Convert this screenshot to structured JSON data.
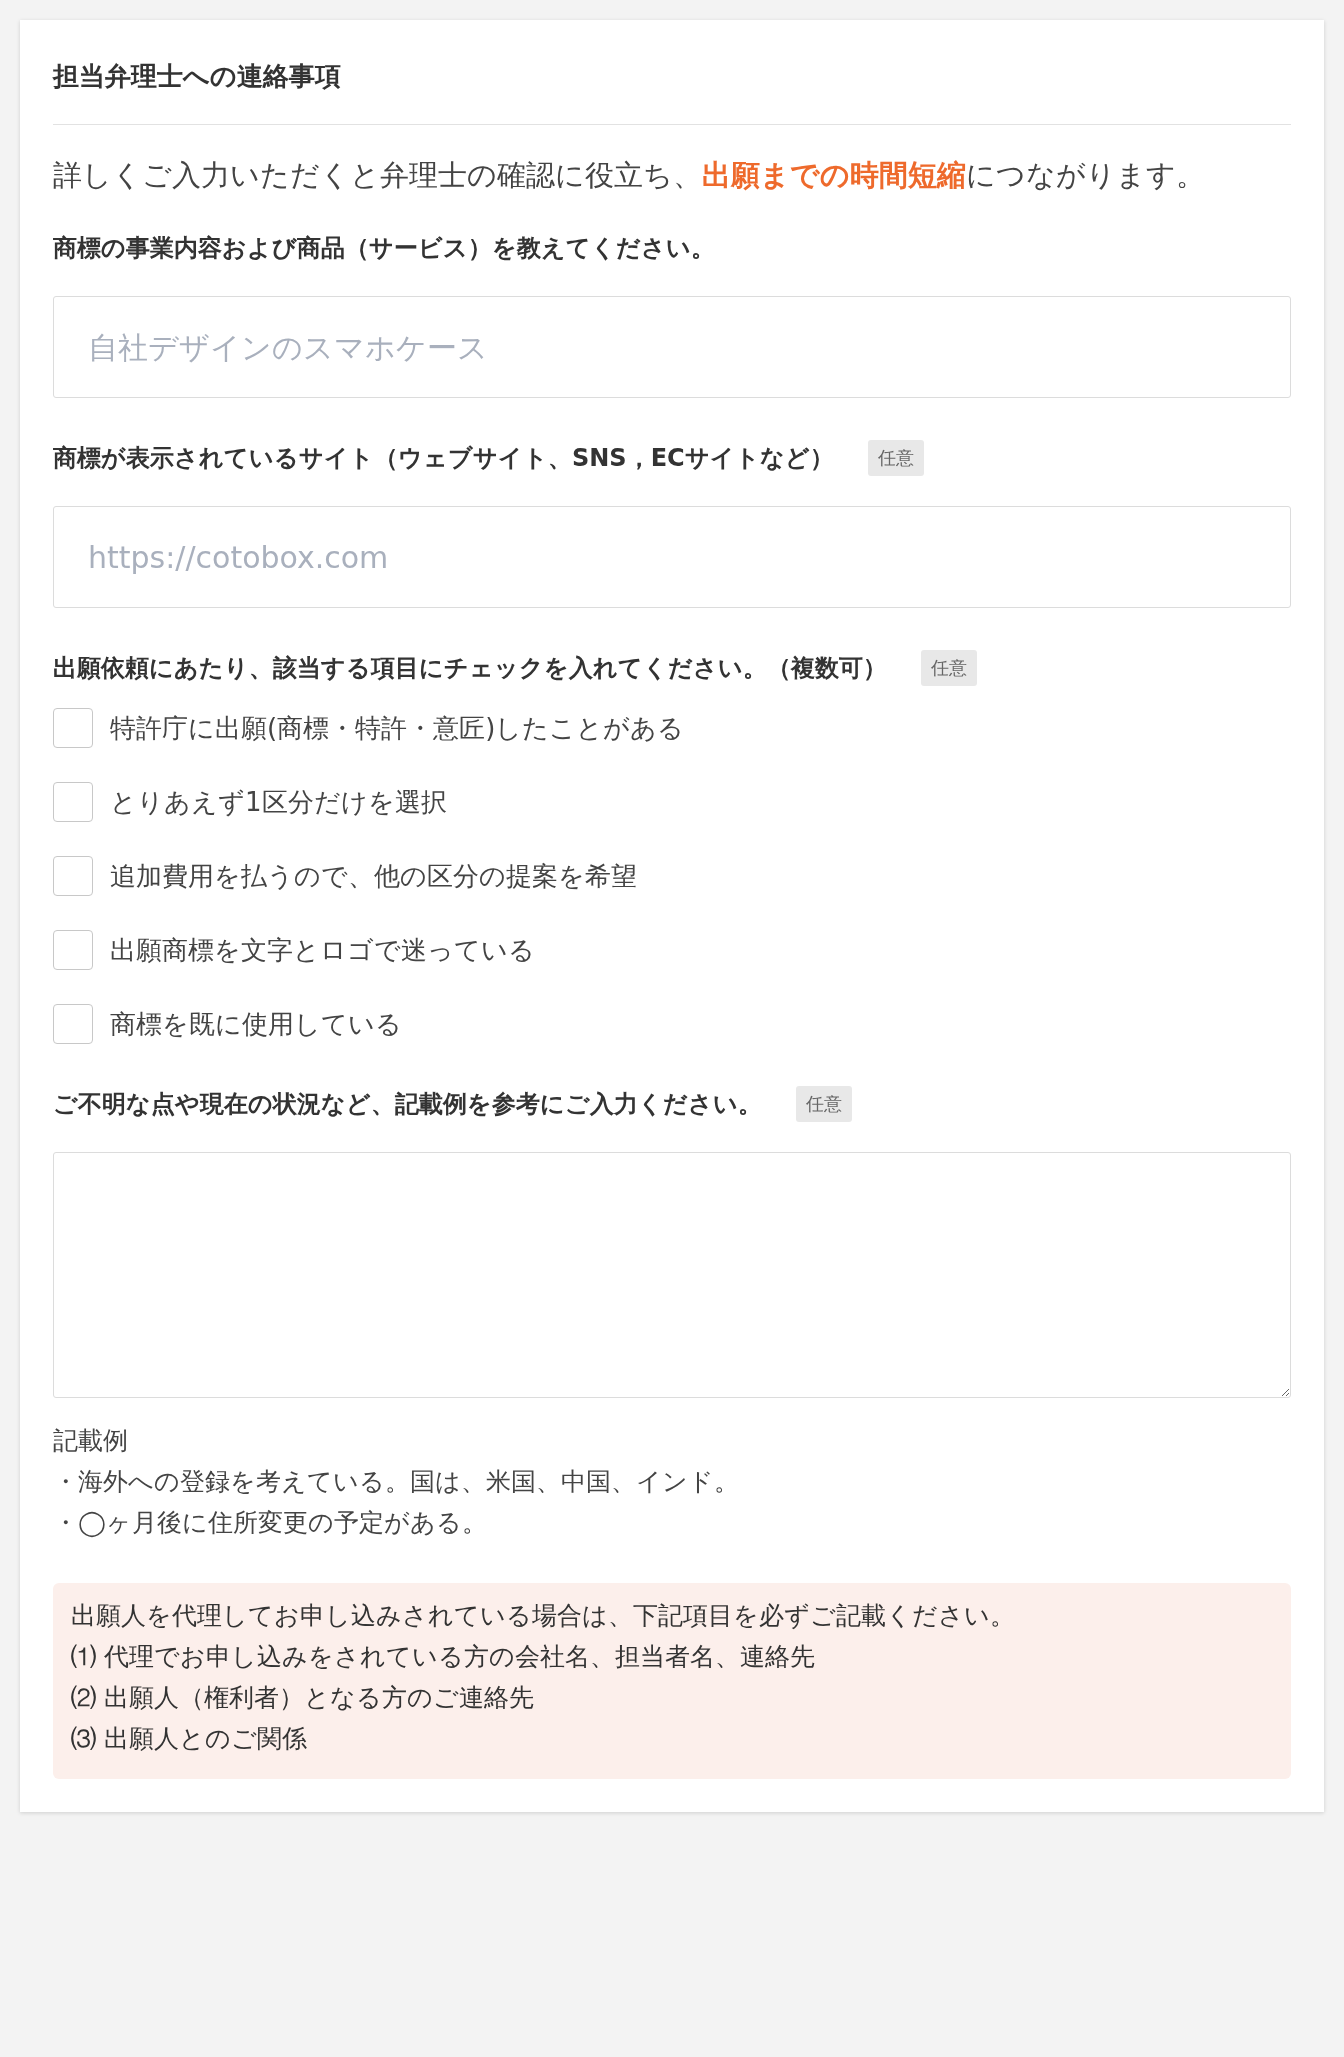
{
  "title": "担当弁理士への連絡事項",
  "intro": "詳しくご入力いただくと弁理士の確認に役立ち、**出願までの時間短縮**につながります。",
  "questions": [
    {
      "kind": "input",
      "label": "商標の事業内容および商品（サービス）を教えてください。",
      "placeholder": "自社デザインのスマホケース"
    },
    {
      "kind": "input",
      "label": "商標が表示されているサイト（ウェブサイト、SNS，ECサイトなど）",
      "badge": "任意",
      "placeholder": "https://cotobox.com"
    },
    {
      "kind": "checkboxes",
      "label": "出願依頼にあたり、該当する項目にチェックを入れてください。（複数可）",
      "badge": "任意",
      "options": [
        {
          "label": "特許庁に出願(商標・特許・意匠)したことがある",
          "checked": false
        },
        {
          "label": "とりあえず1区分だけを選択",
          "checked": false
        },
        {
          "label": "追加費用を払うので、他の区分の提案を希望",
          "checked": false
        },
        {
          "label": "出願商標を文字とロゴで迷っている",
          "checked": false
        },
        {
          "label": "商標を既に使用している",
          "checked": false
        }
      ]
    },
    {
      "kind": "textarea",
      "label": "ご不明な点や現在の状況など、記載例を参考にご入力ください。",
      "badge": "任意"
    }
  ],
  "example": {
    "heading": "記載例",
    "lines": [
      "・海外への登録を考えている。国は、米国、中国、インド。",
      "・◯ヶ月後に住所変更の予定がある。"
    ]
  },
  "notice": {
    "lines": [
      "出願人を代理してお申し込みされている場合は、下記項目を必ずご記載ください。",
      "⑴ 代理でお申し込みをされている方の会社名、担当者名、連絡先",
      "⑵ 出願人（権利者）となる方のご連絡先",
      "⑶ 出願人とのご関係"
    ]
  }
}
